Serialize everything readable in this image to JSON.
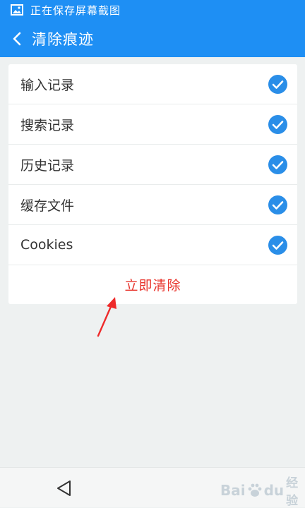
{
  "status_bar": {
    "text": "正在保存屏幕截图",
    "icon": "image-icon"
  },
  "header": {
    "title": "清除痕迹",
    "back_icon": "chevron-left-icon",
    "color": "#1e8ff4"
  },
  "options": [
    {
      "label": "输入记录",
      "checked": true
    },
    {
      "label": "搜索记录",
      "checked": true
    },
    {
      "label": "历史记录",
      "checked": true
    },
    {
      "label": "缓存文件",
      "checked": true
    },
    {
      "label": "Cookies",
      "checked": true
    }
  ],
  "clear_button": {
    "label": "立即清除",
    "color": "#e8322a"
  },
  "check_color": "#2a8ee8",
  "nav": {
    "back_icon": "triangle-back-icon"
  },
  "watermark": {
    "text_left": "Bai",
    "text_right": "du",
    "sub": "经验"
  }
}
